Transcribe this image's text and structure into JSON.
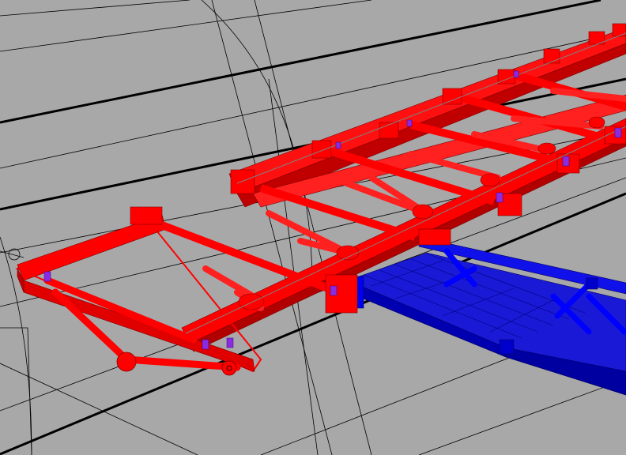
{
  "viewport": {
    "background": "#a8a8a8",
    "grid_color": "#000000",
    "selected_color": "#ff0000",
    "secondary_color": "#0000ff",
    "joint_marker_color": "#8a2be2"
  },
  "objects": [
    {
      "id": "red-truss",
      "color": "#ff0000",
      "state": "selected"
    },
    {
      "id": "blue-truss",
      "color": "#0000ff",
      "state": "unselected"
    }
  ]
}
